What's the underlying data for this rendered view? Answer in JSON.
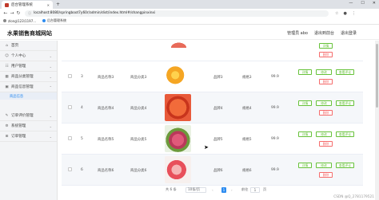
{
  "browser": {
    "tab_title": "后台管理系统",
    "url": "localhost:8080/springboot7y60r/admin/dist/index.html#/shangpinxinxi",
    "bookmarks": [
      "zlong\\123\\1197...",
      "后台管理系统"
    ]
  },
  "app": {
    "title": "水果销售商城网站",
    "header_links": [
      "管理员 abo",
      "退出到前台",
      "退出登录"
    ]
  },
  "sidebar": {
    "items": [
      {
        "label": "首页",
        "icon": "home-icon"
      },
      {
        "label": "个人中心",
        "icon": "user-icon"
      },
      {
        "label": "用户管理",
        "icon": "users-icon"
      },
      {
        "label": "商品分类管理",
        "icon": "grid-icon"
      },
      {
        "label": "商品信息管理",
        "icon": "box-icon"
      },
      {
        "label": "订单评价管理",
        "icon": "comment-icon"
      },
      {
        "label": "系统管理",
        "icon": "gear-icon"
      },
      {
        "label": "订单管理",
        "icon": "cart-icon"
      }
    ],
    "active_sub": "商品信息"
  },
  "table": {
    "rows": [
      {
        "index": "3",
        "name": "商品名称3",
        "category": "商品分类3",
        "image": "orange",
        "brand": "品牌3",
        "spec": "规格3",
        "price": "99.9"
      },
      {
        "index": "4",
        "name": "商品名称4",
        "category": "商品分类4",
        "image": "red",
        "brand": "品牌4",
        "spec": "规格4",
        "price": "99.9"
      },
      {
        "index": "5",
        "name": "商品名称5",
        "category": "商品分类5",
        "image": "pink",
        "brand": "品牌5",
        "spec": "规格5",
        "price": "99.9"
      },
      {
        "index": "6",
        "name": "商品名称6",
        "category": "商品分类6",
        "image": "peach",
        "brand": "品牌6",
        "spec": "规格6",
        "price": "99.9"
      }
    ],
    "actions": {
      "detail": "详情",
      "edit": "修改",
      "review": "查看评论",
      "delete": "删除"
    }
  },
  "pagination": {
    "total": "共 6 条",
    "page_size": "10条/页",
    "current_page": "1",
    "goto_label": "前往",
    "goto_value": "1",
    "page_suffix": "页"
  },
  "watermark": "CSDN @Q_2781179521",
  "colors": {
    "primary": "#2d8cf0",
    "success": "#67c23a",
    "danger": "#f56c6c"
  }
}
